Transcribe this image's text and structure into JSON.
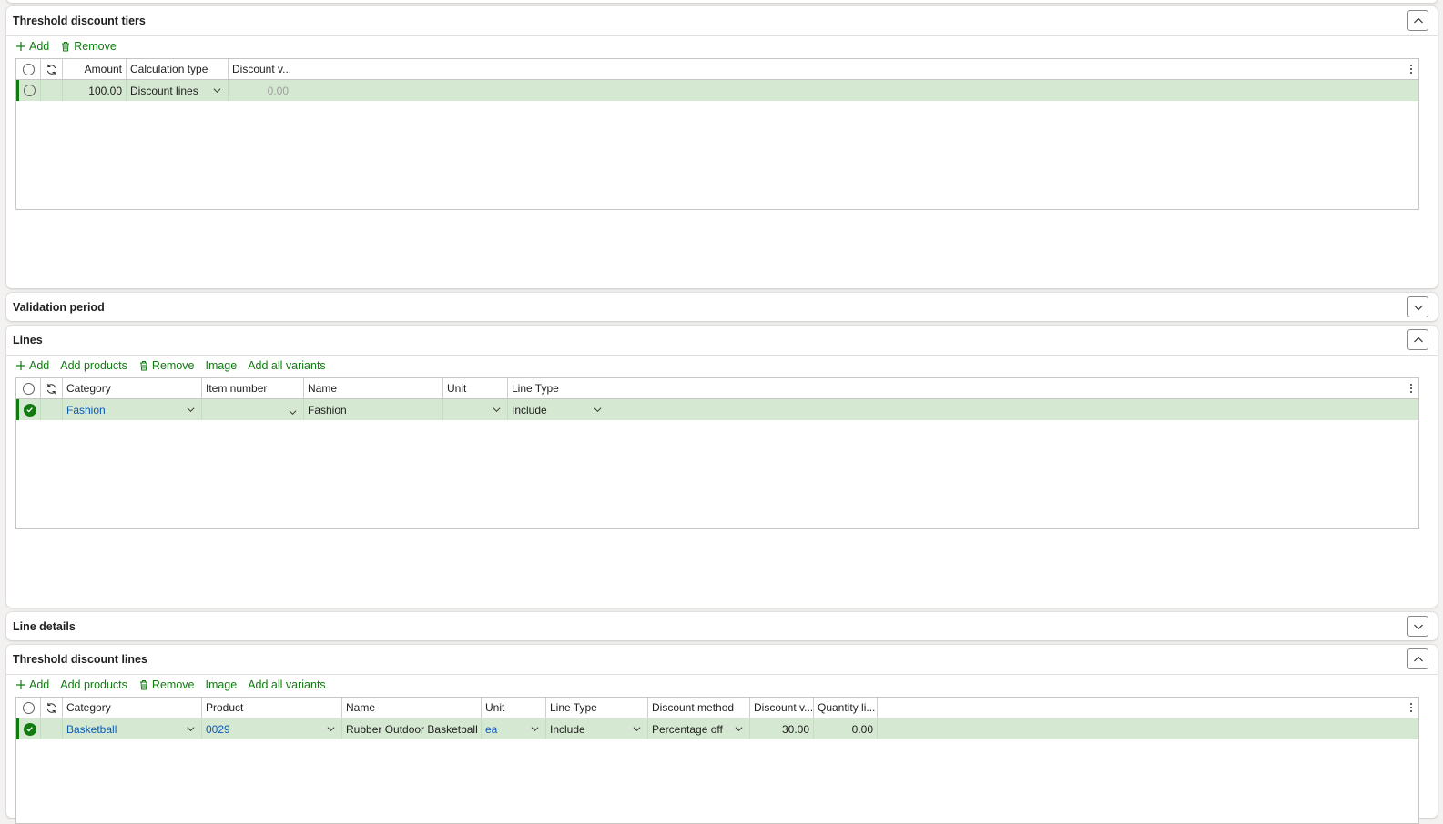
{
  "tiers": {
    "title": "Threshold discount tiers",
    "toolbar": {
      "add": "Add",
      "remove": "Remove"
    },
    "columns": {
      "amount": "Amount",
      "calc_type": "Calculation type",
      "discount_value": "Discount v..."
    },
    "row": {
      "amount": "100.00",
      "calc_type": "Discount lines",
      "discount_value": "0.00"
    }
  },
  "validation": {
    "title": "Validation period"
  },
  "lines": {
    "title": "Lines",
    "toolbar": {
      "add": "Add",
      "add_products": "Add products",
      "remove": "Remove",
      "image": "Image",
      "add_all_variants": "Add all variants"
    },
    "columns": {
      "category": "Category",
      "item_number": "Item number",
      "name": "Name",
      "unit": "Unit",
      "line_type": "Line Type"
    },
    "row": {
      "category": "Fashion",
      "item_number": "",
      "name": "Fashion",
      "unit": "",
      "line_type": "Include"
    }
  },
  "line_details": {
    "title": "Line details"
  },
  "threshold_lines": {
    "title": "Threshold discount lines",
    "toolbar": {
      "add": "Add",
      "add_products": "Add products",
      "remove": "Remove",
      "image": "Image",
      "add_all_variants": "Add all variants"
    },
    "columns": {
      "category": "Category",
      "product": "Product",
      "name": "Name",
      "unit": "Unit",
      "line_type": "Line Type",
      "discount_method": "Discount method",
      "discount_value": "Discount v...",
      "quantity_limit": "Quantity li..."
    },
    "row": {
      "category": "Basketball",
      "product": "0029",
      "name": "Rubber Outdoor Basketball",
      "unit": "ea",
      "line_type": "Include",
      "discount_method": "Percentage off",
      "discount_value": "30.00",
      "quantity_limit": "0.00"
    }
  },
  "colors": {
    "accent": "#107c10",
    "row_selected": "#d4e8d2",
    "link": "#0f5ab5"
  }
}
